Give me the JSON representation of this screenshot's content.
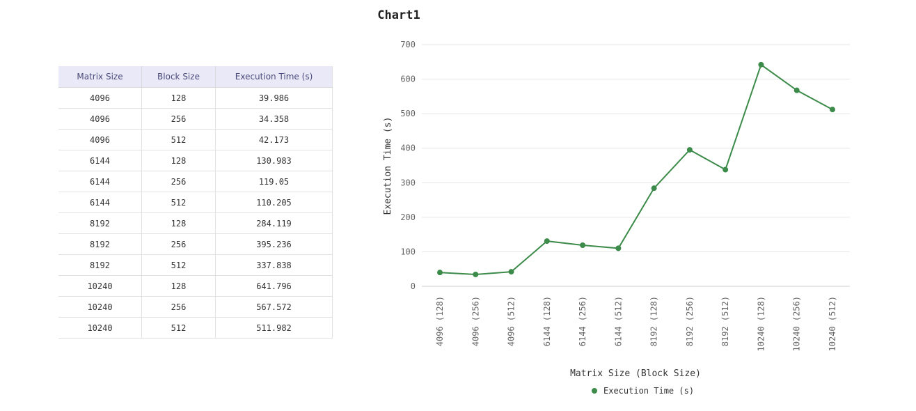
{
  "title": "Chart1",
  "table": {
    "headers": [
      "Matrix Size",
      "Block Size",
      "Execution Time (s)"
    ],
    "rows": [
      [
        "4096",
        "128",
        "39.986"
      ],
      [
        "4096",
        "256",
        "34.358"
      ],
      [
        "4096",
        "512",
        "42.173"
      ],
      [
        "6144",
        "128",
        "130.983"
      ],
      [
        "6144",
        "256",
        "119.05"
      ],
      [
        "6144",
        "512",
        "110.205"
      ],
      [
        "8192",
        "128",
        "284.119"
      ],
      [
        "8192",
        "256",
        "395.236"
      ],
      [
        "8192",
        "512",
        "337.838"
      ],
      [
        "10240",
        "128",
        "641.796"
      ],
      [
        "10240",
        "256",
        "567.572"
      ],
      [
        "10240",
        "512",
        "511.982"
      ]
    ]
  },
  "chart_data": {
    "type": "line",
    "title": "Chart1",
    "xlabel": "Matrix Size (Block Size)",
    "ylabel": "Execution Time (s)",
    "ylim": [
      0,
      700
    ],
    "yticks": [
      0,
      100,
      200,
      300,
      400,
      500,
      600,
      700
    ],
    "grid": true,
    "legend_position": "bottom",
    "categories": [
      "4096 (128)",
      "4096 (256)",
      "4096 (512)",
      "6144 (128)",
      "6144 (256)",
      "6144 (512)",
      "8192 (128)",
      "8192 (256)",
      "8192 (512)",
      "10240 (128)",
      "10240 (256)",
      "10240 (512)"
    ],
    "series": [
      {
        "name": "Execution Time (s)",
        "color": "#3d8b4a",
        "values": [
          39.986,
          34.358,
          42.173,
          130.983,
          119.05,
          110.205,
          284.119,
          395.236,
          337.838,
          641.796,
          567.572,
          511.982
        ]
      }
    ]
  }
}
